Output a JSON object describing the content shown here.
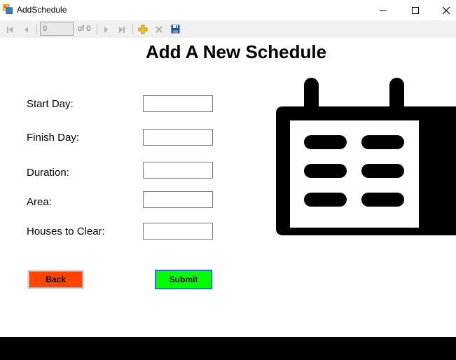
{
  "window": {
    "title": "AddSchedule",
    "icon": "app-form-icon",
    "controls": [
      "minimize-icon",
      "maximize-icon",
      "close-icon"
    ]
  },
  "navigator": {
    "position_value": "0",
    "count_label": "of 0",
    "buttons": [
      "move-first-icon",
      "move-previous-icon",
      "move-next-icon",
      "move-last-icon",
      "add-new-icon",
      "delete-icon",
      "save-icon"
    ]
  },
  "form": {
    "heading": "Add A New Schedule",
    "fields": [
      {
        "label": "Start Day:",
        "value": ""
      },
      {
        "label": "Finish Day:",
        "value": ""
      },
      {
        "label": "Duration:",
        "value": ""
      },
      {
        "label": "Area:",
        "value": ""
      },
      {
        "label": "Houses to Clear:",
        "value": ""
      }
    ],
    "back_label": "Back",
    "submit_label": "Submit"
  },
  "colors": {
    "back_button": "#ff4500",
    "submit_button": "#00ff00",
    "submit_focus_border": "#2276c9",
    "bottom_bar": "#000000"
  },
  "illustration": "calendar-icon"
}
